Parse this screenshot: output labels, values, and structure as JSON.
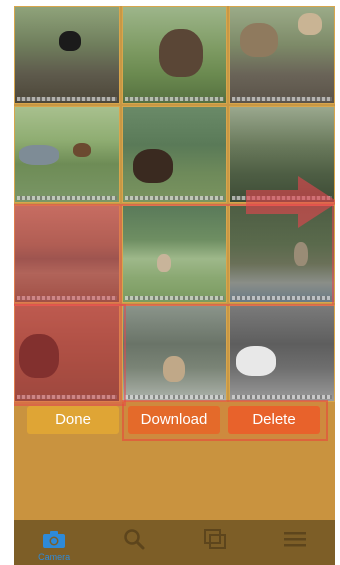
{
  "actions": {
    "done_label": "Done",
    "download_label": "Download",
    "delete_label": "Delete"
  },
  "tabbar": {
    "tabs": [
      {
        "label": "Camera",
        "icon": "camera-icon",
        "active": true
      },
      {
        "label": "",
        "icon": "search-icon",
        "active": false
      },
      {
        "label": "",
        "icon": "photos-icon",
        "active": false
      },
      {
        "label": "",
        "icon": "menu-icon",
        "active": false
      }
    ]
  },
  "photos": [
    {
      "subject": "elk",
      "selected": false
    },
    {
      "subject": "elk",
      "selected": false
    },
    {
      "subject": "elk",
      "selected": false
    },
    {
      "subject": "deer",
      "selected": false
    },
    {
      "subject": "bear",
      "selected": false
    },
    {
      "subject": "forest",
      "selected": false
    },
    {
      "subject": "deer",
      "selected": true
    },
    {
      "subject": "deer",
      "selected": false
    },
    {
      "subject": "elk",
      "selected": false
    },
    {
      "subject": "moose",
      "selected": true
    },
    {
      "subject": "elk",
      "selected": false
    },
    {
      "subject": "elk",
      "selected": false
    }
  ],
  "colors": {
    "background": "#c9933f",
    "tabbar": "#7d5e27",
    "active_tab": "#2e8ad8",
    "selection": "#e8444e",
    "done_button": "#dfa535",
    "download_button": "#e46a2a",
    "delete_button": "#e8622b"
  }
}
